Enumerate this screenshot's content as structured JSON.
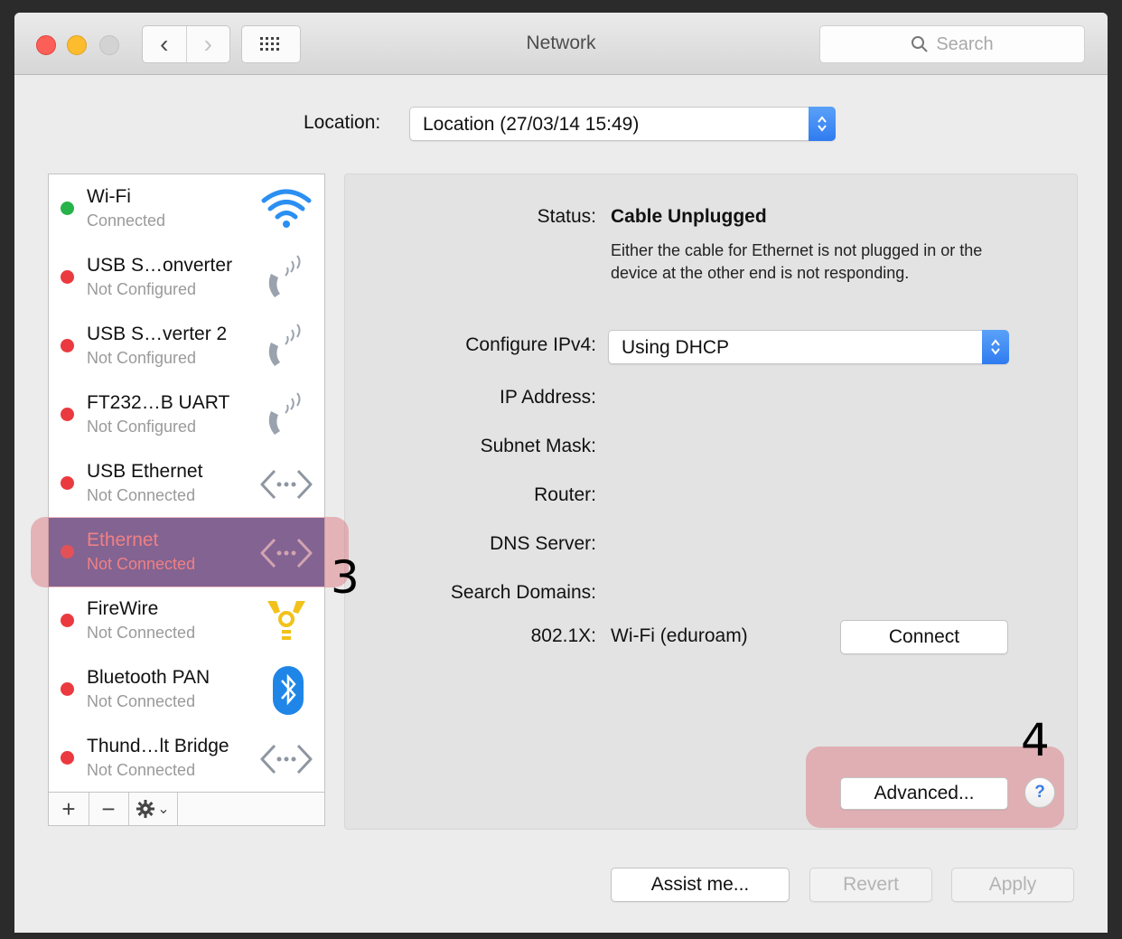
{
  "window": {
    "title": "Network",
    "search_placeholder": "Search",
    "nav_back": "‹",
    "nav_forward": "›"
  },
  "location": {
    "label": "Location:",
    "value": "Location (27/03/14 15:49)"
  },
  "services": [
    {
      "name": "Wi-Fi",
      "status": "Connected",
      "dot": "#27b24a",
      "icon": "wifi-icon"
    },
    {
      "name": "USB S…onverter",
      "status": "Not Configured",
      "dot": "#ea3a3f",
      "icon": "phone-modem-icon"
    },
    {
      "name": "USB S…verter 2",
      "status": "Not Configured",
      "dot": "#ea3a3f",
      "icon": "phone-modem-icon"
    },
    {
      "name": "FT232…B UART",
      "status": "Not Configured",
      "dot": "#ea3a3f",
      "icon": "phone-modem-icon"
    },
    {
      "name": "USB Ethernet",
      "status": "Not Connected",
      "dot": "#ea3a3f",
      "icon": "ethernet-icon"
    },
    {
      "name": "Ethernet",
      "status": "Not Connected",
      "dot": "#ea3a3f",
      "icon": "ethernet-icon",
      "selected": true
    },
    {
      "name": "FireWire",
      "status": "Not Connected",
      "dot": "#ea3a3f",
      "icon": "firewire-icon"
    },
    {
      "name": "Bluetooth PAN",
      "status": "Not Connected",
      "dot": "#ea3a3f",
      "icon": "bluetooth-icon"
    },
    {
      "name": "Thund…lt Bridge",
      "status": "Not Connected",
      "dot": "#ea3a3f",
      "icon": "ethernet-icon"
    }
  ],
  "sidebar_toolbar": {
    "add": "+",
    "remove": "−",
    "gear_caret": "⌄"
  },
  "detail": {
    "status_label": "Status:",
    "status_value": "Cable Unplugged",
    "status_description": "Either the cable for Ethernet is not plugged in or the device at the other end is not responding.",
    "configure_label": "Configure IPv4:",
    "configure_value": "Using DHCP",
    "ip_label": "IP Address:",
    "subnet_label": "Subnet Mask:",
    "router_label": "Router:",
    "dns_label": "DNS Server:",
    "search_domains_label": "Search Domains:",
    "dot1x_label": "802.1X:",
    "dot1x_value": "Wi-Fi (eduroam)",
    "connect_button": "Connect",
    "advanced_button": "Advanced...",
    "help_button": "?"
  },
  "footer": {
    "assist": "Assist me...",
    "revert": "Revert",
    "apply": "Apply"
  },
  "annotations": {
    "step3": "3",
    "step4": "4",
    "highlight_color": "#dc6e78"
  },
  "colors": {
    "selection": "#3a5aa8",
    "accent_blue": "#2f7cf0"
  }
}
